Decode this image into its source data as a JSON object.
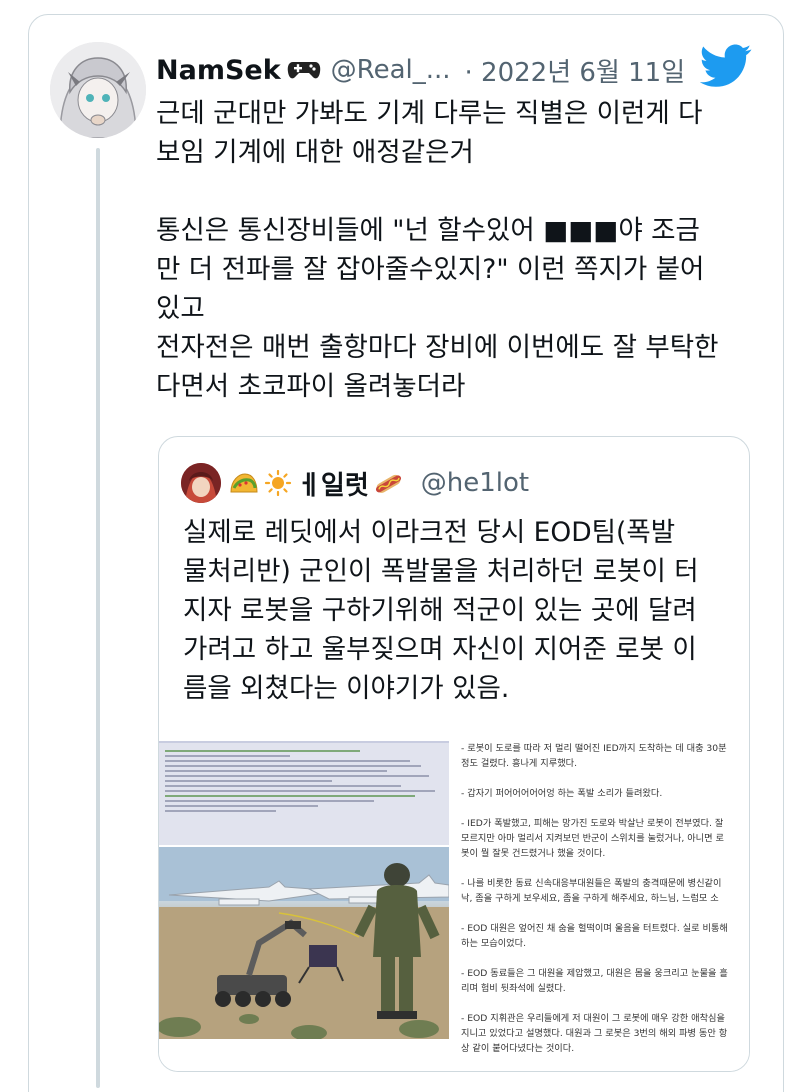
{
  "tweet": {
    "display_name": "NamSek",
    "name_emoji_icon": "gamepad-icon",
    "handle": "@Real_...",
    "date": "· 2022년 6월 11일",
    "brand_icon": "twitter-bird-icon",
    "brand_color": "#1d9bf0",
    "text": "근데 군대만 가봐도 기계 다루는 직별은 이런게 다\n보임 기계에 대한 애정같은거\n\n통신은 통신장비들에 \"넌 할수있어 ■■■야 조금\n만 더 전파를 잘 잡아줄수있지?\" 이런 쪽지가 붙어\n있고\n전자전은 매번 출항마다 장비에 이번에도 잘 부탁한\n다면서 초코파이 올려놓더라"
  },
  "quote": {
    "name_icons": [
      "taco-icon",
      "sun-icon"
    ],
    "display_name": "ㅔ일럿",
    "name_suffix_icon": "hotdog-icon",
    "handle": "@he1lot",
    "text": "실제로 레딧에서 이라크전 당시 EOD팀(폭발\n물처리반) 군인이 폭발물을 처리하던 로봇이 터\n지자 로봇을 구하기위해 적군이 있는 곳에 달려\n가려고 하고 울부짖으며 자신이 지어준 로봇 이\n름을 외쳤다는 이야기가 있음.",
    "image_text": "- 로봇이 도로를 따라 저 멀리 떨어진 IED까지 도착하는 데 대충 30분\n정도 걸렸다. 흥나게 지루했다.\n\n- 갑자기 퍼어어어어어엉 하는 폭발 소리가 들려왔다.\n\n- IED가 폭발했고, 피해는 망가진 도로와 박살난 로봇이 전부였다. 잘\n모르지만 아마 멀리서 지켜보던 반군이 스위치를 눌렀거나, 아니면 로\n봇이 뭘 잘못 건드렸거나 했을 것이다.\n\n- 나를 비롯한 동료 신속대응부대원들은 폭발의 충격때문에 병신같이\n낙, 좀을 구하게 보우세요, 좀을 구하게 해주세요, 하느님, 느럼모 소\n\n- EOD 대원은 엎어진 채 숨을 헐떡이며 울음을 터트렸다. 실로 비통해\n하는 모습이었다.\n\n- EOD 동료들은 그 대원을 제압했고, 대원은 몸을 웅크리고 눈물을 흘\n리며 험비 뒷좌석에 실렸다.\n\n- EOD 지휘관은 우리들에게 저 대원이 그 로봇에 매우 강한 애착심을\n지니고 있었다고 설명했다. 대원과 그 로봇은 3번의 해외 파병 동안 항\n상 같이 붙어다녔다는 것이다."
  }
}
